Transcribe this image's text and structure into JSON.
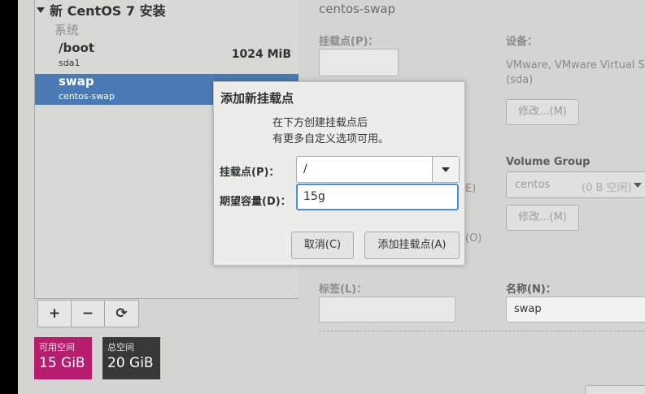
{
  "left": {
    "header": "新 CentOS 7 安装",
    "section": "系统",
    "mount_points": [
      {
        "name": "/boot",
        "device": "sda1",
        "size": "1024 MiB"
      },
      {
        "name": "swap",
        "device": "centos-swap",
        "size": ""
      }
    ],
    "buttons": {
      "add": "+",
      "remove": "−",
      "reload": "⟳"
    },
    "available": {
      "label": "可用空间",
      "value": "15 GiB"
    },
    "total": {
      "label": "总空间",
      "value": "20 GiB"
    }
  },
  "right": {
    "title": "centos-swap",
    "mount_point_label": "挂载点(P)：",
    "device_label": "设备：",
    "device_text": "VMware, VMware Virtual S",
    "device_text2": "(sda)",
    "modify_label": "修改...(M)",
    "partial_1": "E)",
    "partial_2": "(O)",
    "volume_group_label": "Volume Group",
    "volume_group_value": "centos",
    "volume_group_free": "(0 B 空闲)",
    "modify2_label": "修改...(M)",
    "tag_label": "标签(L)：",
    "name_label": "名称(N)：",
    "name_value": "swap"
  },
  "dialog": {
    "title": "添加新挂载点",
    "desc_line1": "在下方创建挂载点后",
    "desc_line2": "有更多自定义选项可用。",
    "mount_label": "挂载点(P)：",
    "mount_value": "/",
    "capacity_label": "期望容量(D)：",
    "capacity_value": "15g",
    "cancel": "取消(C)",
    "add": "添加挂载点(A)"
  },
  "colors": {
    "accent": "#b71c6e",
    "selection": "#4a7ab5",
    "focus": "#4a90d9"
  }
}
